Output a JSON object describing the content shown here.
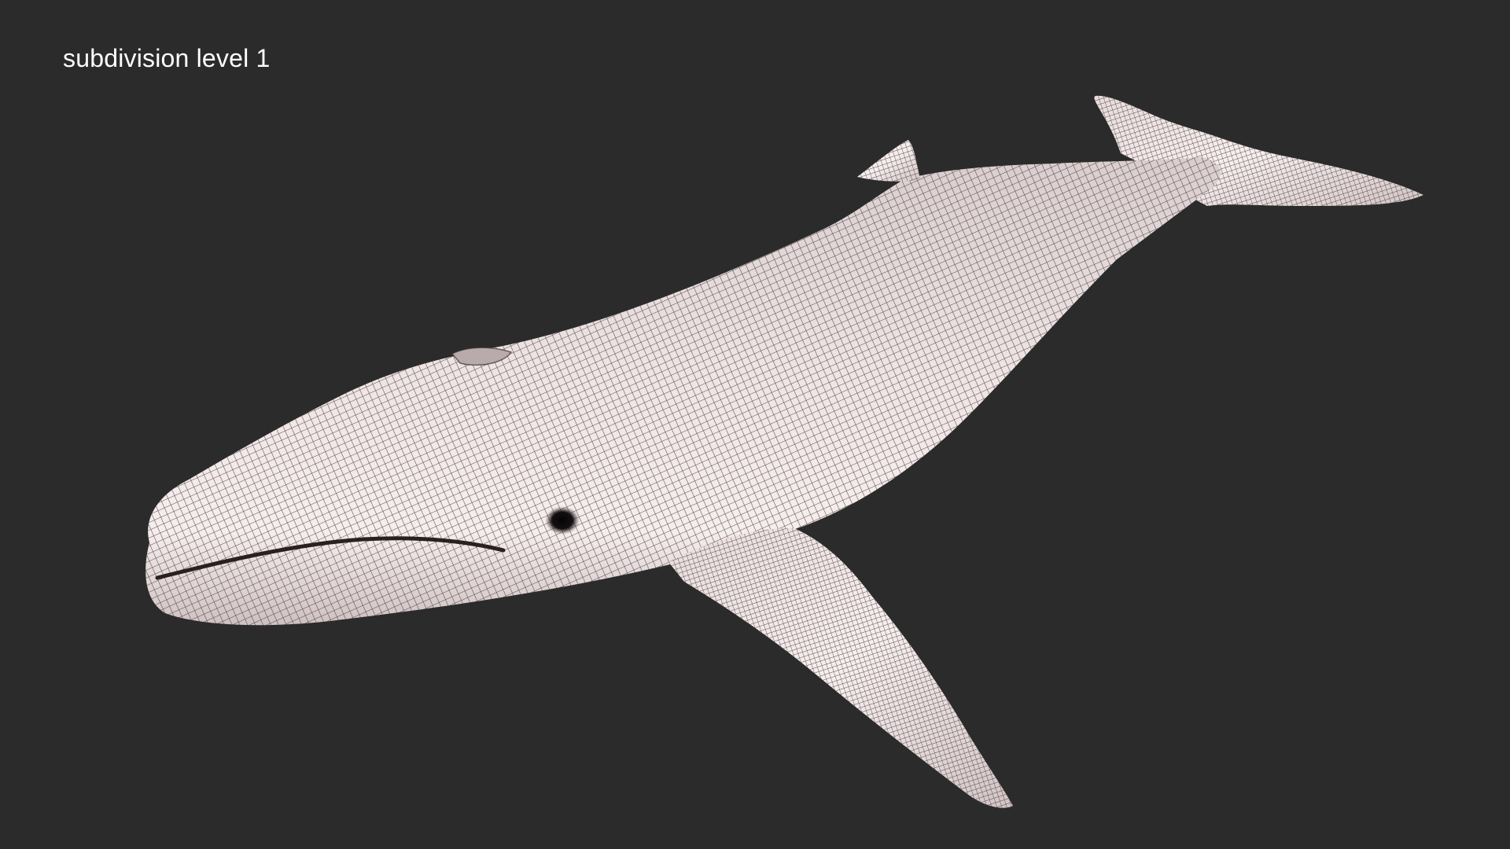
{
  "viewport": {
    "label": "subdivision level 1",
    "background_color": "#2b2b2b",
    "label_color": "#ffffff",
    "model_color": "#efe3e3",
    "wire_color": "#3a2f31",
    "subject_icon": "whale-wireframe-mesh"
  }
}
